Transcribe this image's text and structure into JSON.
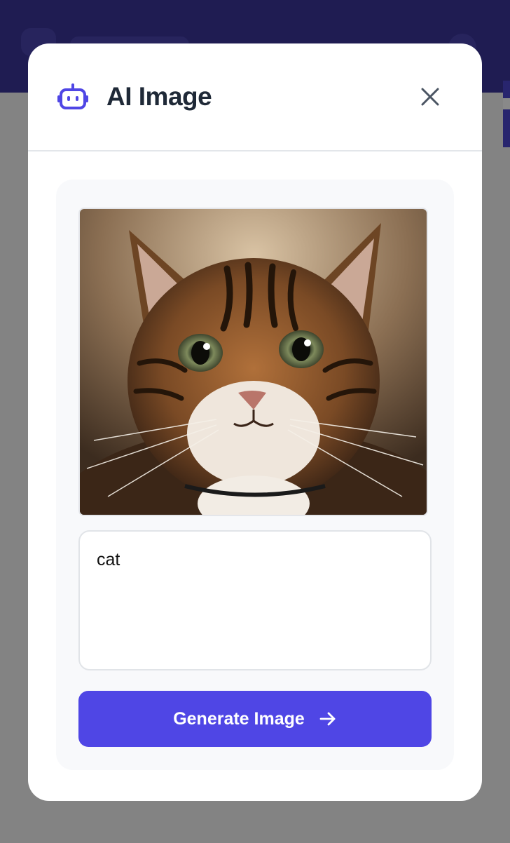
{
  "modal": {
    "title": "AI Image",
    "prompt_value": "cat",
    "generate_label": "Generate Image"
  },
  "image": {
    "alt": "cat",
    "subject": "tabby cat portrait"
  },
  "icons": {
    "title": "robot-icon",
    "close": "close-icon",
    "generate": "arrow-right-icon"
  },
  "colors": {
    "accent": "#4f46e5",
    "header_background": "#2b2590",
    "title_text": "#1f2937"
  }
}
